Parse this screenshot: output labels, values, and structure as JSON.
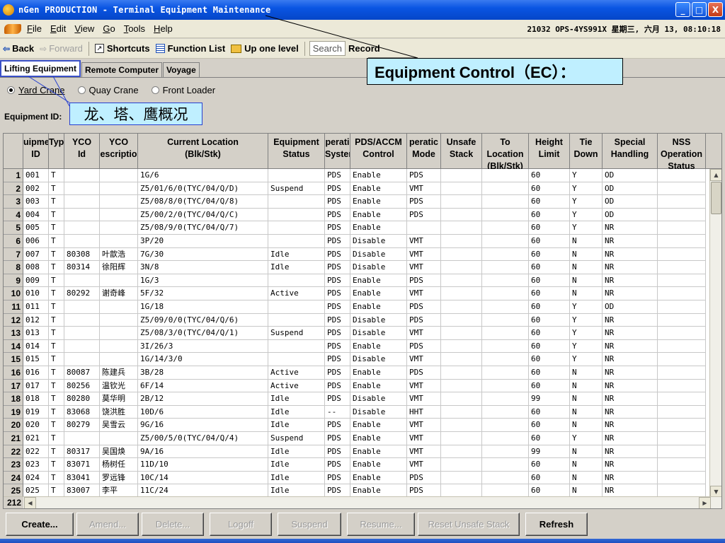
{
  "window": {
    "title": "nGen PRODUCTION - Terminal Equipment Maintenance",
    "controls": [
      "_",
      "□",
      "X"
    ]
  },
  "menu": {
    "items": [
      {
        "label": "File",
        "accel": "F"
      },
      {
        "label": "Edit",
        "accel": "E"
      },
      {
        "label": "View",
        "accel": "V"
      },
      {
        "label": "Go",
        "accel": "G"
      },
      {
        "label": "Tools",
        "accel": "T"
      },
      {
        "label": "Help",
        "accel": "H"
      }
    ],
    "status": "21032 OPS-4YS991X 星期三, 六月 13, 08:10:18"
  },
  "nav": {
    "back": "Back",
    "forward": "Forward",
    "shortcuts": "Shortcuts",
    "function_list": "Function List",
    "up_one_level": "Up one level",
    "search": "Search",
    "record": "Record"
  },
  "tabs": [
    "Lifting Equipment",
    "Remote Computer",
    "Voyage"
  ],
  "radio": [
    {
      "label": "Yard Crane",
      "checked": true
    },
    {
      "label": "Quay Crane",
      "checked": false
    },
    {
      "label": "Front Loader",
      "checked": false
    }
  ],
  "equipment_id_label": "Equipment ID:",
  "callouts": {
    "equipment_control": "Equipment Control（EC）：",
    "chinese_note": "龙、塔、鹰概况"
  },
  "grid": {
    "columns": [
      "uipme\nID",
      "Typ",
      "YCO\nId",
      "YCO\nescriptio",
      "Current Location\n(Blk/Stk)",
      "Equipment\nStatus",
      "perati\nSyster",
      "PDS/ACCM\nControl",
      "peratic\nMode",
      "Unsafe\nStack",
      "To\nLocation\n(Blk/Stk)",
      "Height\nLimit",
      "Tie\nDown",
      "Special\nHandling",
      "NSS\nOperation\nStatus"
    ],
    "rows": [
      [
        "001",
        "T",
        "",
        "",
        "1G/6",
        "",
        "PDS",
        "Enable",
        "PDS",
        "",
        "",
        "60",
        "Y",
        "OD",
        ""
      ],
      [
        "002",
        "T",
        "",
        "",
        "Z5/01/6/0(TYC/04/Q/D)",
        "Suspend",
        "PDS",
        "Enable",
        "VMT",
        "",
        "",
        "60",
        "Y",
        "OD",
        ""
      ],
      [
        "003",
        "T",
        "",
        "",
        "Z5/08/8/0(TYC/04/Q/8)",
        "",
        "PDS",
        "Enable",
        "PDS",
        "",
        "",
        "60",
        "Y",
        "OD",
        ""
      ],
      [
        "004",
        "T",
        "",
        "",
        "Z5/00/2/0(TYC/04/Q/C)",
        "",
        "PDS",
        "Enable",
        "PDS",
        "",
        "",
        "60",
        "Y",
        "OD",
        ""
      ],
      [
        "005",
        "T",
        "",
        "",
        "Z5/08/9/0(TYC/04/Q/7)",
        "",
        "PDS",
        "Enable",
        "",
        "",
        "",
        "60",
        "Y",
        "NR",
        ""
      ],
      [
        "006",
        "T",
        "",
        "",
        "3P/20",
        "",
        "PDS",
        "Disable",
        "VMT",
        "",
        "",
        "60",
        "N",
        "NR",
        ""
      ],
      [
        "007",
        "T",
        "80308",
        "叶歆浩",
        "7G/30",
        "Idle",
        "PDS",
        "Disable",
        "VMT",
        "",
        "",
        "60",
        "N",
        "NR",
        ""
      ],
      [
        "008",
        "T",
        "80314",
        "徐阳辉",
        "3N/8",
        "Idle",
        "PDS",
        "Disable",
        "VMT",
        "",
        "",
        "60",
        "N",
        "NR",
        ""
      ],
      [
        "009",
        "T",
        "",
        "",
        "1G/3",
        "",
        "PDS",
        "Enable",
        "PDS",
        "",
        "",
        "60",
        "N",
        "NR",
        ""
      ],
      [
        "010",
        "T",
        "80292",
        "谢奇峰",
        "5F/32",
        "Active",
        "PDS",
        "Enable",
        "VMT",
        "",
        "",
        "60",
        "N",
        "NR",
        ""
      ],
      [
        "011",
        "T",
        "",
        "",
        "1G/18",
        "",
        "PDS",
        "Enable",
        "PDS",
        "",
        "",
        "60",
        "Y",
        "OD",
        ""
      ],
      [
        "012",
        "T",
        "",
        "",
        "Z5/09/0/0(TYC/04/Q/6)",
        "",
        "PDS",
        "Disable",
        "PDS",
        "",
        "",
        "60",
        "Y",
        "NR",
        ""
      ],
      [
        "013",
        "T",
        "",
        "",
        "Z5/08/3/0(TYC/04/Q/1)",
        "Suspend",
        "PDS",
        "Disable",
        "VMT",
        "",
        "",
        "60",
        "Y",
        "NR",
        ""
      ],
      [
        "014",
        "T",
        "",
        "",
        "3I/26/3",
        "",
        "PDS",
        "Enable",
        "PDS",
        "",
        "",
        "60",
        "Y",
        "NR",
        ""
      ],
      [
        "015",
        "T",
        "",
        "",
        "1G/14/3/0",
        "",
        "PDS",
        "Disable",
        "VMT",
        "",
        "",
        "60",
        "Y",
        "NR",
        ""
      ],
      [
        "016",
        "T",
        "80087",
        "陈建兵",
        "3B/28",
        "Active",
        "PDS",
        "Enable",
        "PDS",
        "",
        "",
        "60",
        "N",
        "NR",
        ""
      ],
      [
        "017",
        "T",
        "80256",
        "温钦光",
        "6F/14",
        "Active",
        "PDS",
        "Enable",
        "VMT",
        "",
        "",
        "60",
        "N",
        "NR",
        ""
      ],
      [
        "018",
        "T",
        "80280",
        "莫华明",
        "2B/12",
        "Idle",
        "PDS",
        "Disable",
        "VMT",
        "",
        "",
        "99",
        "N",
        "NR",
        ""
      ],
      [
        "019",
        "T",
        "83068",
        "饶洪胜",
        "10D/6",
        "Idle",
        "--",
        "Disable",
        "HHT",
        "",
        "",
        "60",
        "N",
        "NR",
        ""
      ],
      [
        "020",
        "T",
        "80279",
        "吴雪云",
        "9G/16",
        "Idle",
        "PDS",
        "Enable",
        "VMT",
        "",
        "",
        "60",
        "N",
        "NR",
        ""
      ],
      [
        "021",
        "T",
        "",
        "",
        "Z5/00/5/0(TYC/04/Q/4)",
        "Suspend",
        "PDS",
        "Enable",
        "VMT",
        "",
        "",
        "60",
        "Y",
        "NR",
        ""
      ],
      [
        "022",
        "T",
        "80317",
        "吴国焕",
        "9A/16",
        "Idle",
        "PDS",
        "Enable",
        "VMT",
        "",
        "",
        "99",
        "N",
        "NR",
        ""
      ],
      [
        "023",
        "T",
        "83071",
        "杨树任",
        "11D/10",
        "Idle",
        "PDS",
        "Enable",
        "VMT",
        "",
        "",
        "60",
        "N",
        "NR",
        ""
      ],
      [
        "024",
        "T",
        "83041",
        "罗远锋",
        "10C/14",
        "Idle",
        "PDS",
        "Enable",
        "PDS",
        "",
        "",
        "60",
        "N",
        "NR",
        ""
      ],
      [
        "025",
        "T",
        "83007",
        "李平",
        "11C/24",
        "Idle",
        "PDS",
        "Enable",
        "PDS",
        "",
        "",
        "60",
        "N",
        "NR",
        ""
      ]
    ],
    "total_rows": "212"
  },
  "buttons": [
    {
      "label": "Create...",
      "enabled": true
    },
    {
      "label": "Amend...",
      "enabled": false
    },
    {
      "label": "Delete...",
      "enabled": false
    },
    {
      "label": "Logoff",
      "enabled": false
    },
    {
      "label": "Suspend",
      "enabled": false
    },
    {
      "label": "Resume...",
      "enabled": false
    },
    {
      "label": "Reset Unsafe Stack",
      "enabled": false
    },
    {
      "label": "Refresh",
      "enabled": true
    }
  ]
}
